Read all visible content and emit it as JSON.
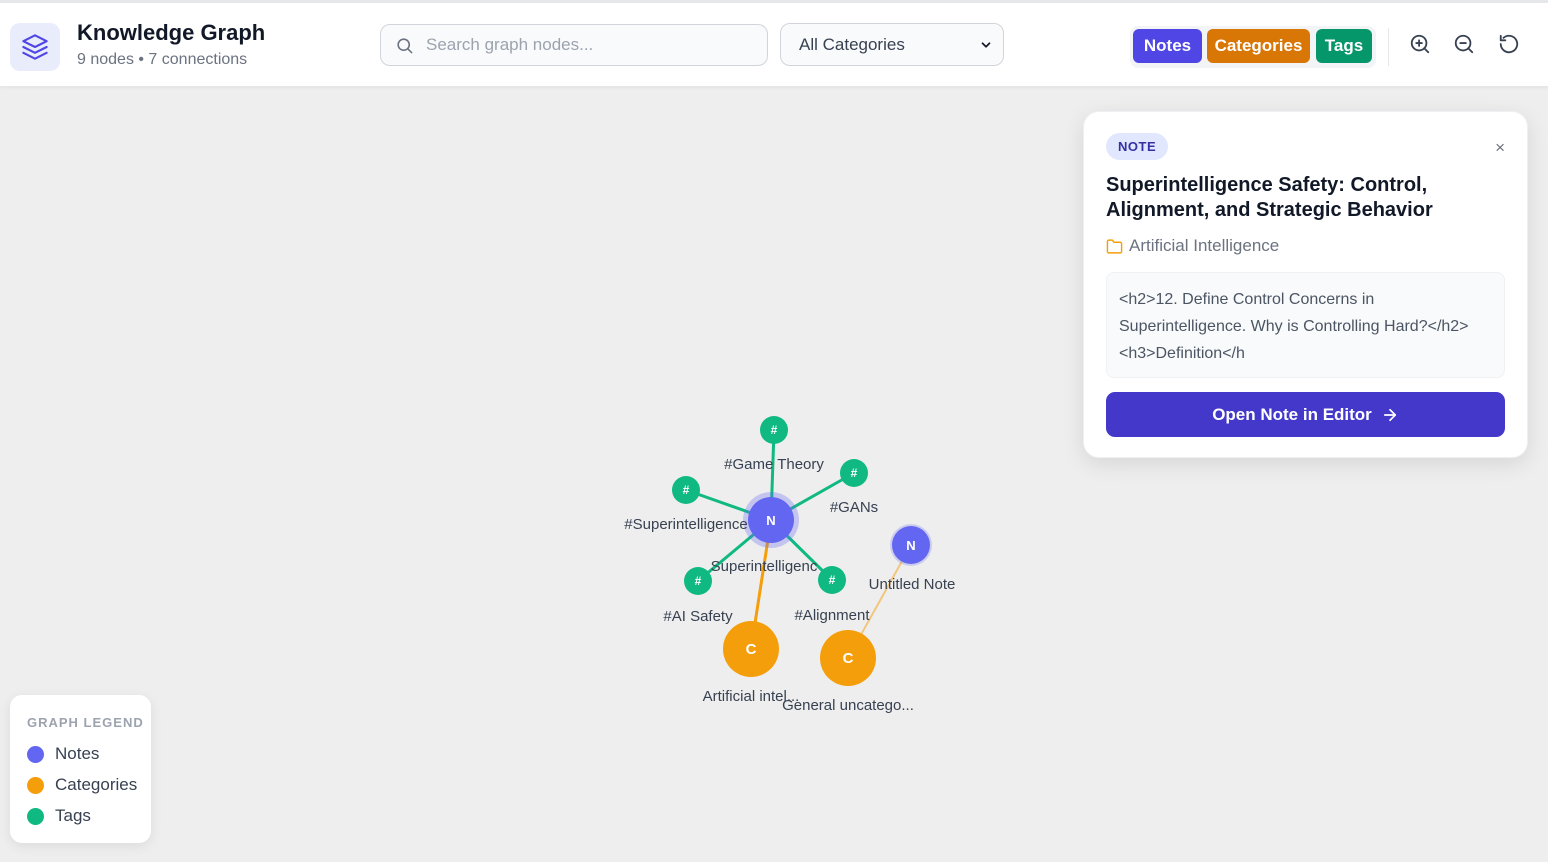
{
  "header": {
    "title": "Knowledge Graph",
    "subtitle": "9 nodes • 7 connections",
    "search_placeholder": "Search graph nodes...",
    "category_select": "All Categories",
    "filters": {
      "notes": "Notes",
      "categories": "Categories",
      "tags": "Tags"
    }
  },
  "colors": {
    "note": "#6366f1",
    "category": "#f59e0b",
    "tag": "#10b981",
    "accent": "#4338ca"
  },
  "graph": {
    "nodes": [
      {
        "id": "n1",
        "type": "note",
        "letter": "N",
        "label": "Superintelligenc",
        "selected": true
      },
      {
        "id": "n2",
        "type": "note",
        "letter": "N",
        "label": "Untitled Note"
      },
      {
        "id": "c1",
        "type": "category",
        "letter": "C",
        "label": "Artificial intel..."
      },
      {
        "id": "c2",
        "type": "category",
        "letter": "C",
        "label": "General uncatego..."
      },
      {
        "id": "t1",
        "type": "tag",
        "letter": "#",
        "label": "#Game Theory"
      },
      {
        "id": "t2",
        "type": "tag",
        "letter": "#",
        "label": "#GANs"
      },
      {
        "id": "t3",
        "type": "tag",
        "letter": "#",
        "label": "#Superintelligence"
      },
      {
        "id": "t4",
        "type": "tag",
        "letter": "#",
        "label": "#AI Safety"
      },
      {
        "id": "t5",
        "type": "tag",
        "letter": "#",
        "label": "#Alignment"
      }
    ],
    "edges": [
      {
        "from": "n1",
        "to": "t1"
      },
      {
        "from": "n1",
        "to": "t2"
      },
      {
        "from": "n1",
        "to": "t3"
      },
      {
        "from": "n1",
        "to": "t4"
      },
      {
        "from": "n1",
        "to": "t5"
      },
      {
        "from": "n1",
        "to": "c1"
      },
      {
        "from": "n2",
        "to": "c2"
      }
    ]
  },
  "panel": {
    "badge": "NOTE",
    "close": "×",
    "title": "Superintelligence Safety: Control, Alignment, and Strategic Behavior",
    "category": "Artificial Intelligence",
    "snippet": "<h2>12. Define Control Concerns in Superintelligence. Why is Controlling Hard?</h2><h3>Definition</h",
    "open_button": "Open Note in Editor"
  },
  "legend": {
    "title": "GRAPH LEGEND",
    "items": [
      {
        "label": "Notes",
        "color": "#6366f1"
      },
      {
        "label": "Categories",
        "color": "#f59e0b"
      },
      {
        "label": "Tags",
        "color": "#10b981"
      }
    ]
  }
}
